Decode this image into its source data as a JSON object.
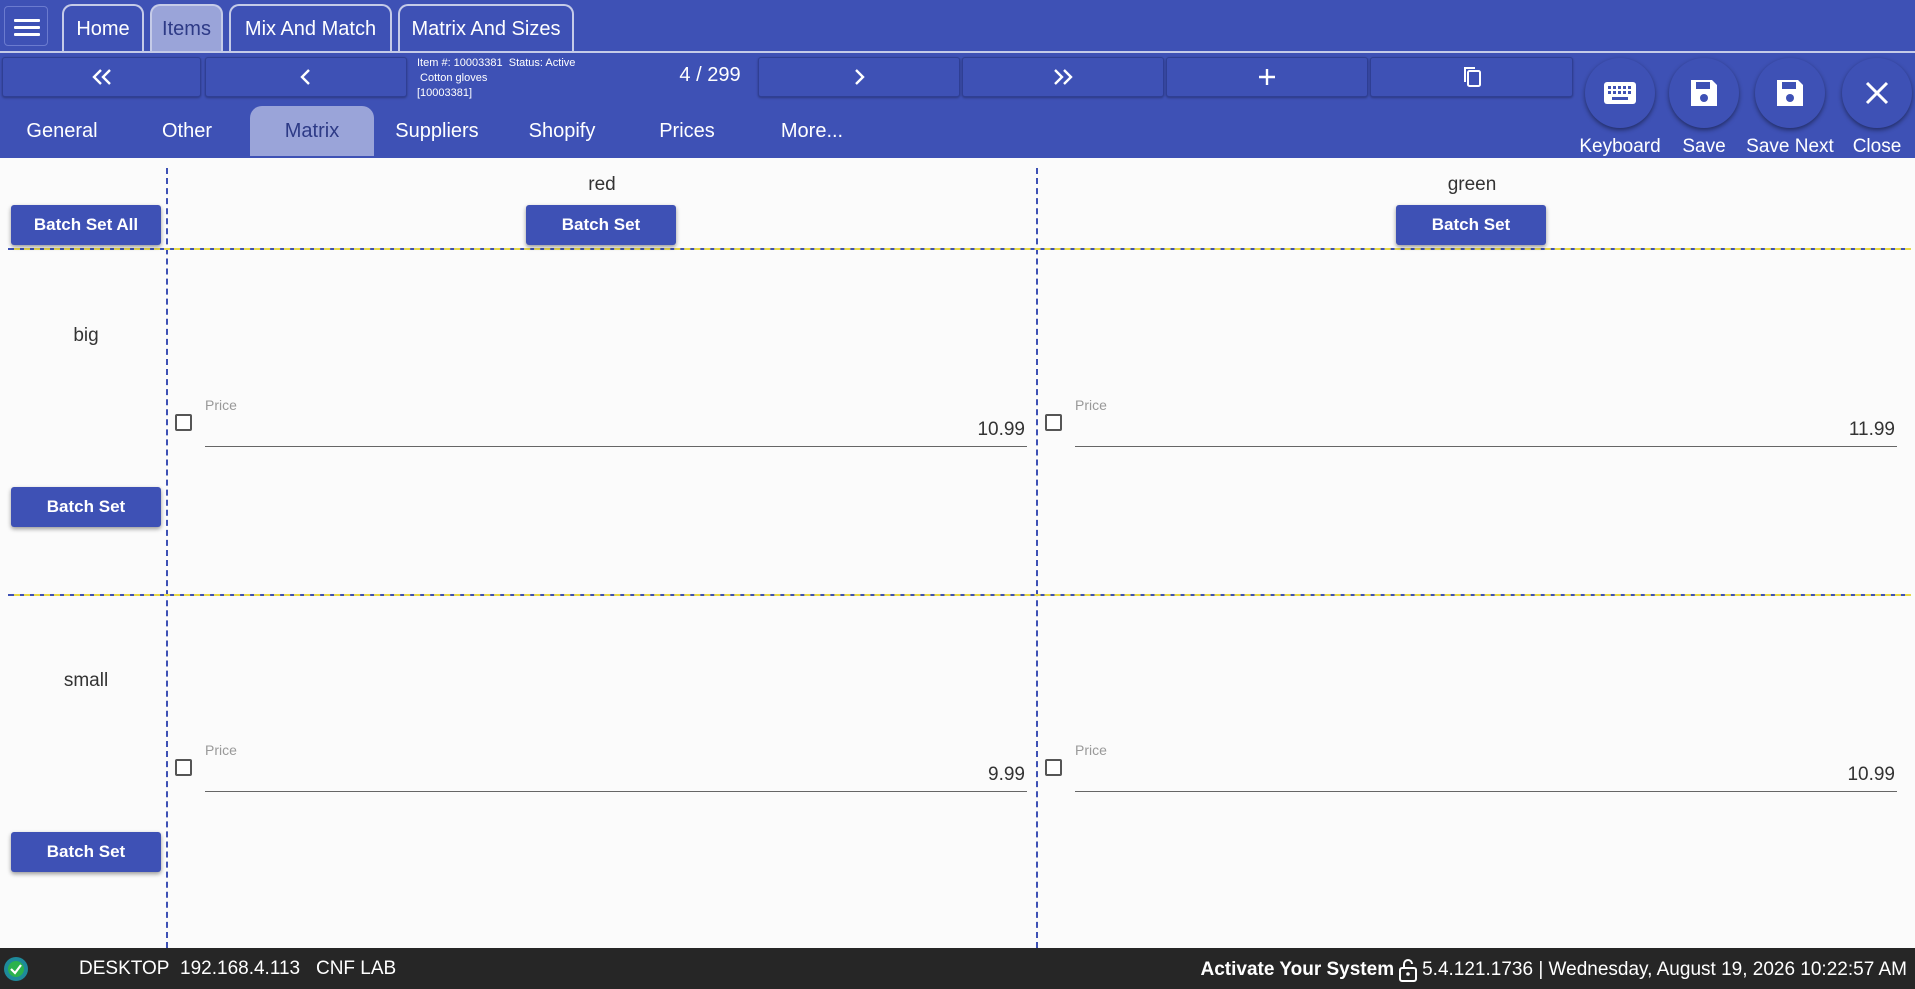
{
  "top_tabs": [
    {
      "label": "Home"
    },
    {
      "label": "Items"
    },
    {
      "label": "Mix And Match"
    },
    {
      "label": "Matrix And Sizes"
    }
  ],
  "active_top_tab": "Items",
  "item": {
    "line1": "Item #: 10003381  Status: Active",
    "line2": " Cotton gloves",
    "line3": "[10003381]"
  },
  "counter": "4 / 299",
  "nav_icons": [
    "double-chevron-left-icon",
    "chevron-left-icon",
    "chevron-right-icon",
    "double-chevron-right-icon",
    "plus-icon",
    "copy-icon"
  ],
  "section_tabs": [
    {
      "label": "General"
    },
    {
      "label": "Other"
    },
    {
      "label": "Matrix"
    },
    {
      "label": "Suppliers"
    },
    {
      "label": "Shopify"
    },
    {
      "label": "Prices"
    },
    {
      "label": "More..."
    }
  ],
  "active_section_tab": "Matrix",
  "actions": {
    "keyboard": "Keyboard",
    "save": "Save",
    "save_next": "Save Next",
    "close": "Close"
  },
  "matrix": {
    "batch_set_all": "Batch Set All",
    "batch_set": "Batch Set",
    "columns": [
      "red",
      "green"
    ],
    "rows": [
      "big",
      "small"
    ],
    "price_label": "Price",
    "cells": [
      [
        "10.99",
        "11.99"
      ],
      [
        "9.99",
        "10.99"
      ]
    ]
  },
  "status": {
    "machine": "DESKTOP",
    "ip": "192.168.4.113",
    "location": "CNF LAB",
    "activate": "Activate Your System",
    "version_time": "5.4.121.1736 | Wednesday, August 19, 2026 10:22:57 AM"
  },
  "colors": {
    "primary": "#3e51b5",
    "active_tab": "#9aa4d9",
    "status_bar": "#262626"
  }
}
